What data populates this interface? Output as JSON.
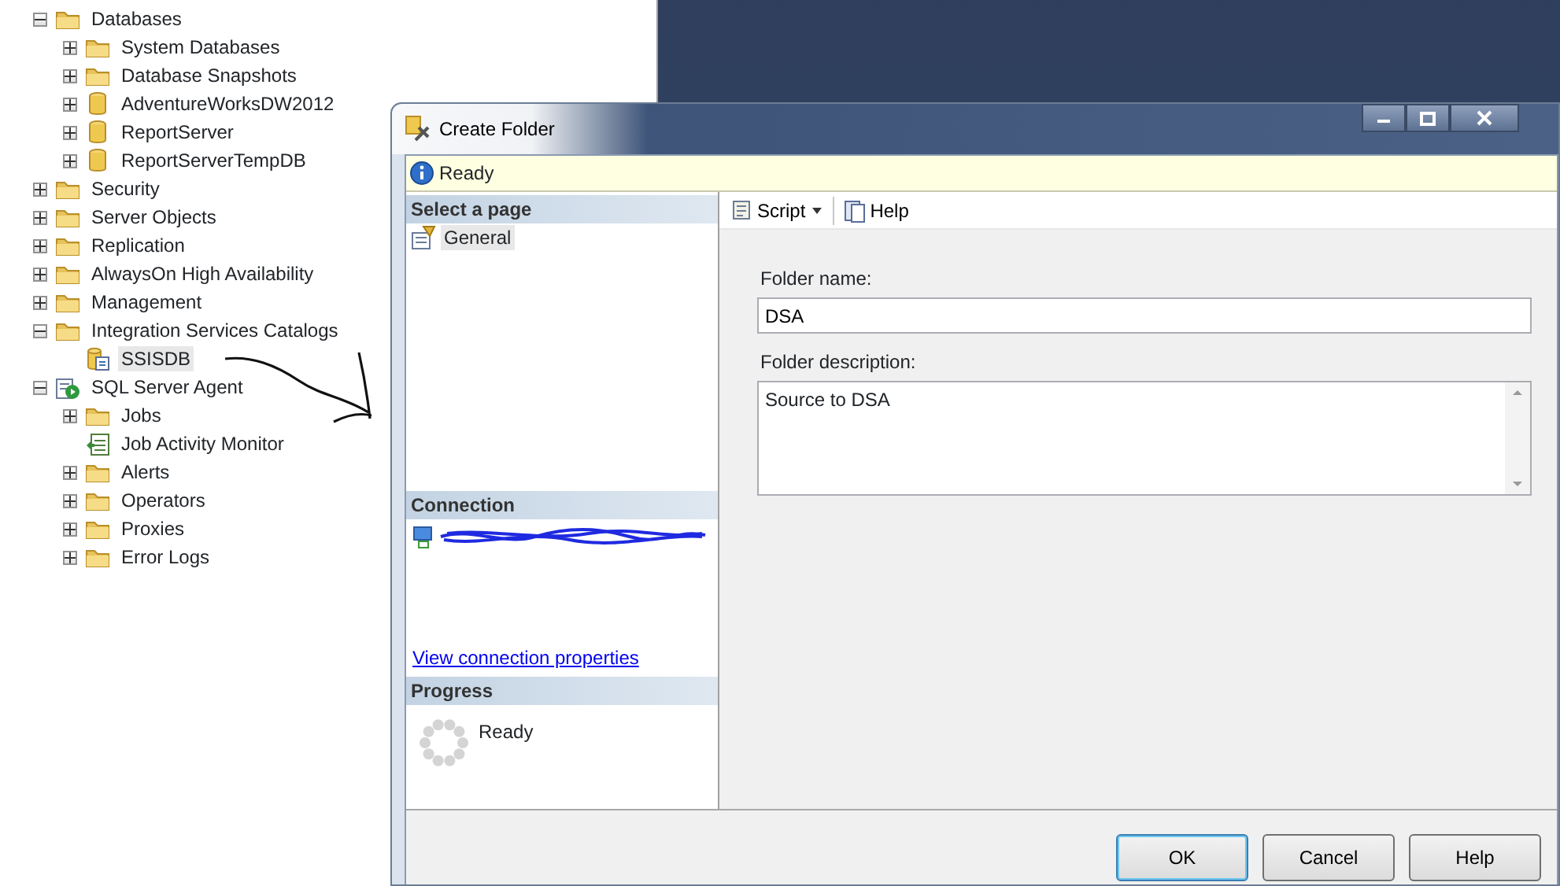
{
  "object_explorer": {
    "nodes": [
      {
        "label": "Databases",
        "kind": "folder",
        "expanded": true,
        "selected": false,
        "children": [
          {
            "label": "System Databases",
            "kind": "folder",
            "expanded": false,
            "selected": false
          },
          {
            "label": "Database Snapshots",
            "kind": "folder",
            "expanded": false,
            "selected": false
          },
          {
            "label": "AdventureWorksDW2012",
            "kind": "database",
            "expanded": false,
            "selected": false
          },
          {
            "label": "ReportServer",
            "kind": "database",
            "expanded": false,
            "selected": false
          },
          {
            "label": "ReportServerTempDB",
            "kind": "database",
            "expanded": false,
            "selected": false
          }
        ]
      },
      {
        "label": "Security",
        "kind": "folder",
        "expanded": false,
        "selected": false
      },
      {
        "label": "Server Objects",
        "kind": "folder",
        "expanded": false,
        "selected": false
      },
      {
        "label": "Replication",
        "kind": "folder",
        "expanded": false,
        "selected": false
      },
      {
        "label": "AlwaysOn High Availability",
        "kind": "folder",
        "expanded": false,
        "selected": false
      },
      {
        "label": "Management",
        "kind": "folder",
        "expanded": false,
        "selected": false
      },
      {
        "label": "Integration Services Catalogs",
        "kind": "folder",
        "expanded": true,
        "selected": false,
        "children": [
          {
            "label": "SSISDB",
            "kind": "catalog",
            "leaf": true,
            "selected": true
          }
        ]
      },
      {
        "label": "SQL Server Agent",
        "kind": "agent",
        "expanded": true,
        "selected": false,
        "children": [
          {
            "label": "Jobs",
            "kind": "folder",
            "expanded": false,
            "selected": false
          },
          {
            "label": "Job Activity Monitor",
            "kind": "monitor",
            "leaf": true,
            "selected": false
          },
          {
            "label": "Alerts",
            "kind": "folder",
            "expanded": false,
            "selected": false
          },
          {
            "label": "Operators",
            "kind": "folder",
            "expanded": false,
            "selected": false
          },
          {
            "label": "Proxies",
            "kind": "folder",
            "expanded": false,
            "selected": false
          },
          {
            "label": "Error Logs",
            "kind": "folder",
            "expanded": false,
            "selected": false
          }
        ]
      }
    ]
  },
  "dialog": {
    "title": "Create Folder",
    "status": "Ready",
    "select_page": {
      "header": "Select a page",
      "pages": [
        {
          "label": "General",
          "selected": true
        }
      ]
    },
    "connection": {
      "header": "Connection",
      "link": "View connection properties"
    },
    "progress": {
      "header": "Progress",
      "status": "Ready"
    },
    "toolbar": {
      "script": "Script",
      "help": "Help"
    },
    "fields": [
      {
        "label": "Folder name:",
        "kind": "input",
        "value": "DSA"
      },
      {
        "label": "Folder description:",
        "kind": "textarea",
        "value": "Source to DSA"
      }
    ],
    "buttons": [
      {
        "label": "OK",
        "default": true
      },
      {
        "label": "Cancel",
        "default": false
      },
      {
        "label": "Help",
        "default": false
      }
    ]
  }
}
